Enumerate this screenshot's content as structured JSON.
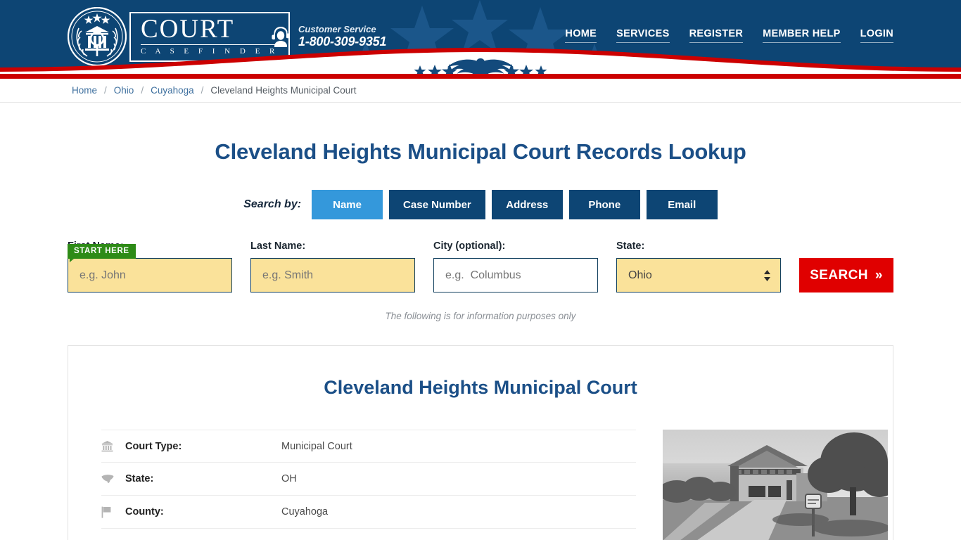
{
  "header": {
    "logo": {
      "word": "COURT",
      "sub": "C A S E   F I N D E R",
      "icon": "court-emblem-icon"
    },
    "customer_service": {
      "label": "Customer Service",
      "phone": "1-800-309-9351",
      "icon": "headset-support-icon"
    },
    "nav": [
      {
        "label": "HOME"
      },
      {
        "label": "SERVICES"
      },
      {
        "label": "REGISTER"
      },
      {
        "label": "MEMBER HELP"
      },
      {
        "label": "LOGIN"
      }
    ],
    "decoration": {
      "eagle_icon": "eagle-icon",
      "stars_icon": "star-icon"
    },
    "colors": {
      "navy": "#0d4574",
      "red": "#cc0000",
      "white": "#ffffff"
    }
  },
  "breadcrumb": {
    "items": [
      {
        "label": "Home",
        "current": false
      },
      {
        "label": "Ohio",
        "current": false
      },
      {
        "label": "Cuyahoga",
        "current": false
      },
      {
        "label": "Cleveland Heights Municipal Court",
        "current": true
      }
    ],
    "separator": "/"
  },
  "main": {
    "page_title": "Cleveland Heights Municipal Court Records Lookup",
    "search_by_label": "Search by:",
    "tabs": [
      {
        "label": "Name",
        "active": true
      },
      {
        "label": "Case Number",
        "active": false
      },
      {
        "label": "Address",
        "active": false
      },
      {
        "label": "Phone",
        "active": false
      },
      {
        "label": "Email",
        "active": false
      }
    ],
    "start_here_badge": "START HERE",
    "form": {
      "first_name": {
        "label": "First Name:",
        "value": "",
        "placeholder": "e.g. John"
      },
      "last_name": {
        "label": "Last Name:",
        "value": "",
        "placeholder": "e.g. Smith"
      },
      "city": {
        "label": "City (optional):",
        "value": "",
        "placeholder": "e.g.  Columbus"
      },
      "state": {
        "label": "State:",
        "value": "Ohio",
        "options": [
          "Ohio"
        ]
      },
      "search_button": "SEARCH",
      "search_button_chevron": "»"
    },
    "info_note": "The following is for information purposes only"
  },
  "card": {
    "title": "Cleveland Heights Municipal Court",
    "rows": [
      {
        "icon": "bank-icon",
        "key": "Court Type:",
        "value": "Municipal Court"
      },
      {
        "icon": "usa-map-icon",
        "key": "State:",
        "value": "OH"
      },
      {
        "icon": "flag-icon",
        "key": "County:",
        "value": "Cuyahoga"
      }
    ],
    "photo_alt": "courthouse-photo"
  }
}
